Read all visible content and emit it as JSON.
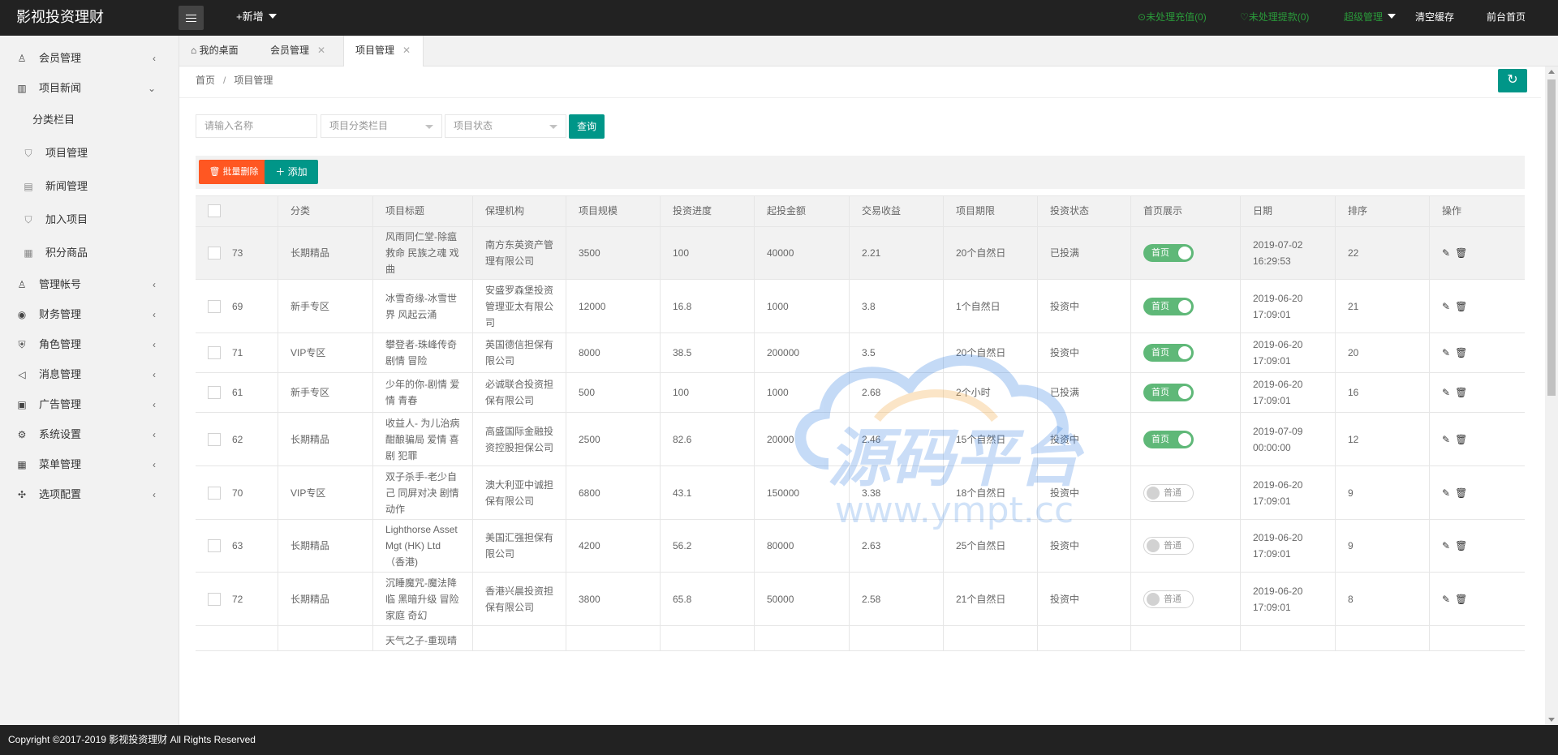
{
  "header": {
    "brand": "影视投资理财",
    "new_label": "+新增",
    "pending_recharge": "未处理充值(0)",
    "pending_withdraw": "未处理提款(0)",
    "admin_label": "超级管理",
    "clear_cache": "清空缓存",
    "frontend_home": "前台首页",
    "colors": {
      "accent": "#009688",
      "danger": "#ff5722",
      "switch_on": "#5fb878",
      "link_green": "#2a9a3a"
    }
  },
  "sidebar": {
    "items": [
      {
        "icon": "user-icon",
        "glyph": "♙",
        "label": "会员管理",
        "chevron": "‹"
      },
      {
        "icon": "book-icon",
        "glyph": "▥",
        "label": "项目新闻",
        "chevron": "⌄"
      },
      {
        "icon": "",
        "glyph": "",
        "label": "分类栏目",
        "chevron": ""
      },
      {
        "icon": "cart-icon",
        "glyph": "⛉",
        "label": "项目管理",
        "chevron": ""
      },
      {
        "icon": "document-icon",
        "glyph": "▤",
        "label": "新闻管理",
        "chevron": ""
      },
      {
        "icon": "cart-icon",
        "glyph": "⛉",
        "label": "加入项目",
        "chevron": ""
      },
      {
        "icon": "grid-icon",
        "glyph": "▦",
        "label": "积分商品",
        "chevron": ""
      },
      {
        "icon": "users-icon",
        "glyph": "♙",
        "label": "管理帐号",
        "chevron": "‹"
      },
      {
        "icon": "money-icon",
        "glyph": "◉",
        "label": "财务管理",
        "chevron": "‹"
      },
      {
        "icon": "shield-icon",
        "glyph": "⛨",
        "label": "角色管理",
        "chevron": "‹"
      },
      {
        "icon": "speaker-icon",
        "glyph": "◁",
        "label": "消息管理",
        "chevron": "‹"
      },
      {
        "icon": "image-icon",
        "glyph": "▣",
        "label": "广告管理",
        "chevron": "‹"
      },
      {
        "icon": "gear-icon",
        "glyph": "⚙",
        "label": "系统设置",
        "chevron": "‹"
      },
      {
        "icon": "menu-grid-icon",
        "glyph": "▦",
        "label": "菜单管理",
        "chevron": "‹"
      },
      {
        "icon": "config-icon",
        "glyph": "✣",
        "label": "选项配置",
        "chevron": "‹"
      }
    ]
  },
  "tabs": [
    {
      "label": "我的桌面",
      "icon": "home-icon"
    },
    {
      "label": "会员管理",
      "close": "✕"
    },
    {
      "label": "项目管理",
      "close": "✕"
    }
  ],
  "breadcrumb": {
    "home": "首页",
    "separator": "/",
    "current": "项目管理"
  },
  "search": {
    "name_placeholder": "请输入名称",
    "category_select": "项目分类栏目",
    "status_select": "项目状态",
    "query_button": "查询"
  },
  "toolbar": {
    "batch_delete": "批量删除",
    "add": "添加"
  },
  "table": {
    "columns": [
      "分类",
      "项目标题",
      "保理机构",
      "项目规模",
      "投资进度",
      "起投金额",
      "交易收益",
      "项目期限",
      "投资状态",
      "首页展示",
      "日期",
      "排序",
      "操作"
    ],
    "rows": [
      {
        "id": "73",
        "category": "长期精品",
        "title": "风雨同仁堂-除瘟救命 民族之魂 戏曲",
        "agency": "南方东英资产管理有限公司",
        "scale": "3500",
        "progress": "100",
        "min_invest": "40000",
        "yield": "2.21",
        "term": "20个自然日",
        "status": "已投满",
        "home_on": true,
        "home_label": "首页",
        "date": "2019-07-02 16:29:53",
        "sort": "22"
      },
      {
        "id": "69",
        "category": "新手专区",
        "title": "冰雪奇缘-冰雪世界 风起云涌",
        "agency": "安盛罗森堡投资管理亚太有限公司",
        "scale": "12000",
        "progress": "16.8",
        "min_invest": "1000",
        "yield": "3.8",
        "term": "1个自然日",
        "status": "投资中",
        "home_on": true,
        "home_label": "首页",
        "date": "2019-06-20 17:09:01",
        "sort": "21"
      },
      {
        "id": "71",
        "category": "VIP专区",
        "title": "攀登者-珠峰传奇 剧情 冒险",
        "agency": "英国德信担保有限公司",
        "scale": "8000",
        "progress": "38.5",
        "min_invest": "200000",
        "yield": "3.5",
        "term": "20个自然日",
        "status": "投资中",
        "home_on": true,
        "home_label": "首页",
        "date": "2019-06-20 17:09:01",
        "sort": "20"
      },
      {
        "id": "61",
        "category": "新手专区",
        "title": "少年的你-剧情 爱情 青春",
        "agency": "必诚联合投资担保有限公司",
        "scale": "500",
        "progress": "100",
        "min_invest": "1000",
        "yield": "2.68",
        "term": "2个小时",
        "status": "已投满",
        "home_on": true,
        "home_label": "首页",
        "date": "2019-06-20 17:09:01",
        "sort": "16"
      },
      {
        "id": "62",
        "category": "长期精品",
        "title": "收益人- 为儿治病 酣酿骗局 爱情 喜剧 犯罪",
        "agency": "高盛国际金融投资控股担保公司",
        "scale": "2500",
        "progress": "82.6",
        "min_invest": "20000",
        "yield": "2.46",
        "term": "15个自然日",
        "status": "投资中",
        "home_on": true,
        "home_label": "首页",
        "date": "2019-07-09 00:00:00",
        "sort": "12"
      },
      {
        "id": "70",
        "category": "VIP专区",
        "title": "双子杀手-老少自己 同屏对决 剧情 动作",
        "agency": "澳大利亚中诚担保有限公司",
        "scale": "6800",
        "progress": "43.1",
        "min_invest": "150000",
        "yield": "3.38",
        "term": "18个自然日",
        "status": "投资中",
        "home_on": false,
        "home_label": "普通",
        "date": "2019-06-20 17:09:01",
        "sort": "9"
      },
      {
        "id": "63",
        "category": "长期精品",
        "title": "Lighthorse Asset Mgt (HK) Ltd （香港)",
        "agency": "美国汇强担保有限公司",
        "scale": "4200",
        "progress": "56.2",
        "min_invest": "80000",
        "yield": "2.63",
        "term": "25个自然日",
        "status": "投资中",
        "home_on": false,
        "home_label": "普通",
        "date": "2019-06-20 17:09:01",
        "sort": "9"
      },
      {
        "id": "72",
        "category": "长期精品",
        "title": "沉睡魔咒-魔法降临 黑暗升级 冒险 家庭 奇幻",
        "agency": "香港兴晨投资担保有限公司",
        "scale": "3800",
        "progress": "65.8",
        "min_invest": "50000",
        "yield": "2.58",
        "term": "21个自然日",
        "status": "投资中",
        "home_on": false,
        "home_label": "普通",
        "date": "2019-06-20 17:09:01",
        "sort": "8"
      },
      {
        "id": "",
        "category": "",
        "title": "天气之子-重现晴",
        "agency": "",
        "scale": "",
        "progress": "",
        "min_invest": "",
        "yield": "",
        "term": "",
        "status": "",
        "home_on": null,
        "home_label": "",
        "date": "",
        "sort": ""
      }
    ]
  },
  "watermark": {
    "text": "源码平台",
    "url": "www.ympt.cc"
  },
  "footer": {
    "copyright": "Copyright ©2017-2019 影视投资理财 All Rights Reserved"
  }
}
